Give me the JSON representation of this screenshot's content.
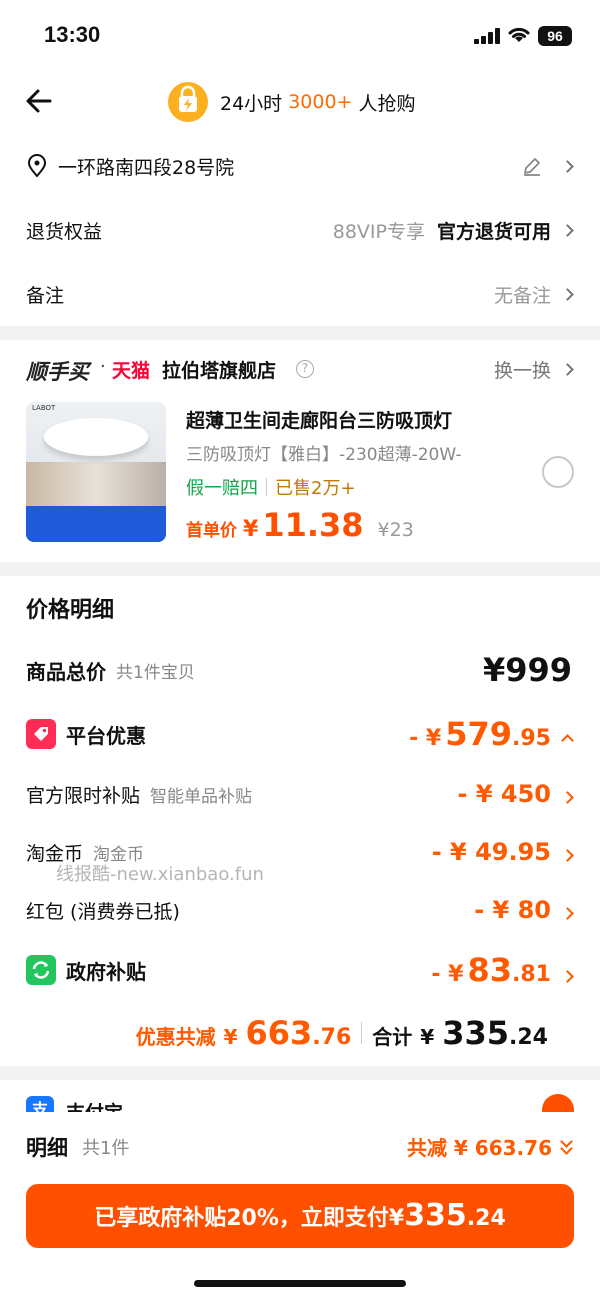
{
  "status": {
    "time": "13:30",
    "battery": "96"
  },
  "nav": {
    "hot_prefix": "24小时",
    "hot_count": "3000+",
    "hot_suffix": "人抢购"
  },
  "address": {
    "text": "一环路南四段28号院"
  },
  "return_rights": {
    "label": "退货权益",
    "vip": "88VIP专享",
    "value": "官方退货可用"
  },
  "note": {
    "label": "备注",
    "value": "无备注"
  },
  "shop": {
    "brand1": "顺手买",
    "dot": "·",
    "brand2": "天猫",
    "name": "拉伯塔旗舰店",
    "help": "?",
    "swap": "换一换"
  },
  "product": {
    "title": "超薄卫生间走廊阳台三防吸顶灯",
    "sku": "三防吸顶灯【雅白】-230超薄-20W-",
    "tag1": "假一赔四",
    "tag2": "已售2万+",
    "first_label": "首单价",
    "currency": "¥",
    "price": "11.38",
    "orig_price": "¥23",
    "thumb_logo": "LABOT"
  },
  "price_detail": {
    "title": "价格明细",
    "total_label": "商品总价",
    "total_sub": "共1件宝贝",
    "total_value": "¥999",
    "platform_label": "平台优惠",
    "platform_prefix": "- ¥",
    "platform_int": "579",
    "platform_dec": ".95",
    "official_label": "官方限时补贴",
    "official_sub": "智能单品补贴",
    "official_value": "- ¥ 450",
    "coin_label": "淘金币",
    "coin_sub": "淘金币",
    "coin_value": "- ¥ 49.95",
    "redpacket_label": "红包 (消费券已抵)",
    "redpacket_value": "- ¥ 80",
    "gov_label": "政府补贴",
    "gov_prefix": "- ¥",
    "gov_int": "83",
    "gov_dec": ".81"
  },
  "watermark": "线报酷-new.xianbao.fun",
  "summary": {
    "discount_label": "优惠共减",
    "discount_prefix": "¥",
    "discount_int": "663",
    "discount_dec": ".76",
    "total_label": "合计",
    "total_prefix": "¥",
    "total_int": "335",
    "total_dec": ".24"
  },
  "payment": {
    "alipay_icon": "支",
    "alipay_label": "支付宝"
  },
  "bottom": {
    "detail_label": "明细",
    "detail_count": "共1件",
    "discount_text": "共减 ¥ 663.76",
    "pay_text": "已享政府补贴20%，立即支付",
    "pay_currency": "¥",
    "pay_int": "335",
    "pay_dec": ".24"
  },
  "colors": {
    "accent": "#ff5000",
    "tmall": "#ff0036",
    "green": "#16a34a",
    "gov_green": "#22c55e",
    "coupon_red": "#ff2d55",
    "alipay_blue": "#1677ff"
  },
  "icons": [
    "back-arrow-icon",
    "lightning-icon",
    "location-pin-icon",
    "edit-pencil-icon",
    "chevron-right-icon",
    "help-circle-icon",
    "coupon-tag-icon",
    "chevron-up-icon",
    "government-subsidy-icon",
    "alipay-icon",
    "check-icon",
    "double-chevron-down-icon"
  ]
}
